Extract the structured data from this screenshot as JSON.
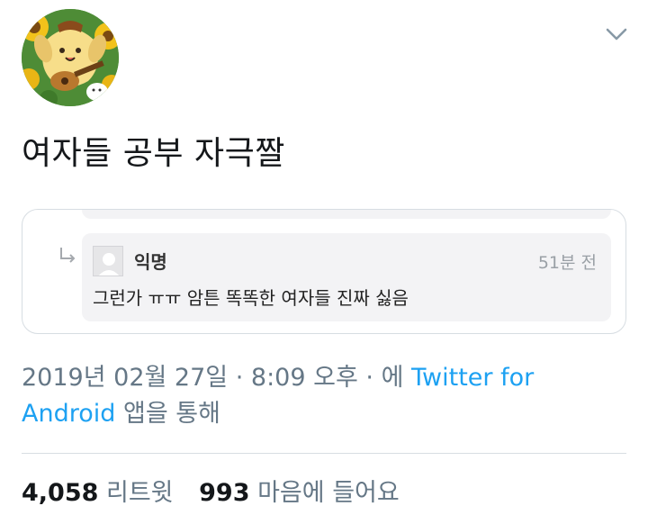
{
  "tweet": {
    "text": "여자들 공부 자극짤",
    "date": "2019년 02월 27일",
    "sep1": "·",
    "time": "8:09 오후",
    "sep2": "·",
    "via_prefix": "에",
    "source_line1": "Twitter for",
    "source_line2": "Android",
    "via_suffix": "앱을 통해",
    "retweet_count": "4,058",
    "retweet_label": "리트윗",
    "like_count": "993",
    "like_label": "마음에 들어요"
  },
  "embedded_comment": {
    "author": "익명",
    "time": "51분 전",
    "body": "그런가 ㅠㅠ 암튼 똑똑한 여자들 진짜 싫음"
  },
  "icons": {
    "avatar": "pompompurin-guitar-avatar",
    "chevron": "chevron-down-icon",
    "reply_arrow": "reply-arrow-icon",
    "anon_avatar": "anonymous-user-icon"
  },
  "colors": {
    "link": "#1da1f2",
    "secondary_text": "#657786",
    "primary_text": "#14171a",
    "comment_bg": "#f3f3f5"
  }
}
